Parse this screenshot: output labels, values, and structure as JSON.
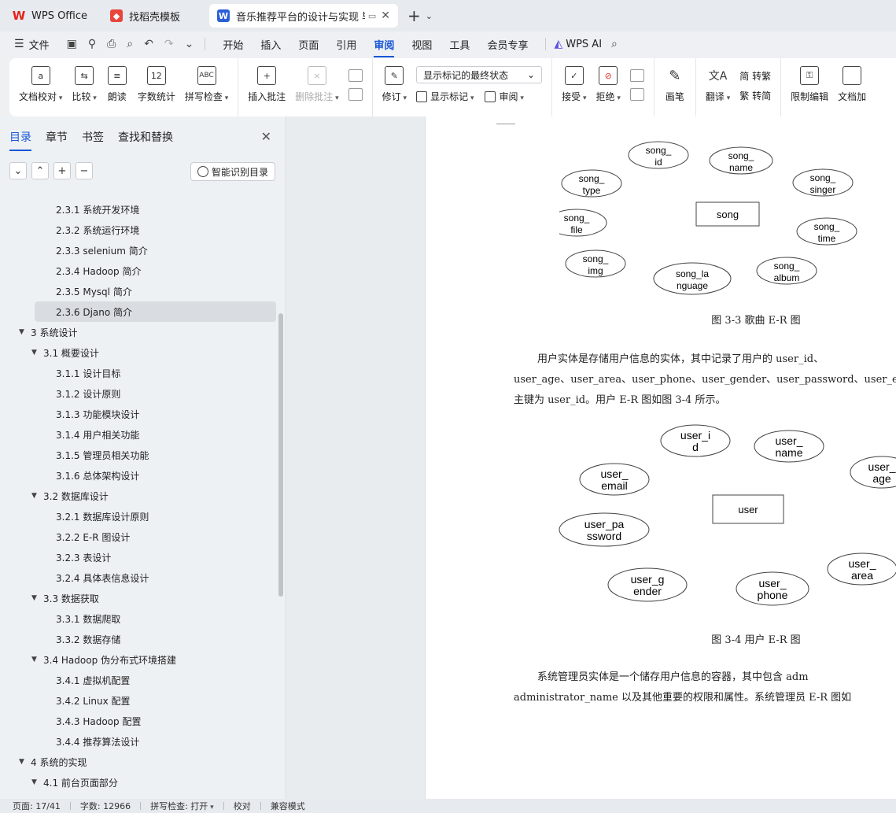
{
  "tabs": [
    {
      "label": "WPS Office"
    },
    {
      "label": "找稻壳模板"
    },
    {
      "label": "音乐推荐平台的设计与实现 毕"
    }
  ],
  "menu": {
    "file": "文件",
    "items": [
      "开始",
      "插入",
      "页面",
      "引用",
      "审阅",
      "视图",
      "工具",
      "会员专享"
    ],
    "active": "审阅",
    "ai": "WPS AI"
  },
  "ribbon": {
    "g1": [
      "文档校对",
      "比较",
      "朗读",
      "字数统计",
      "拼写检查"
    ],
    "g2": [
      "插入批注",
      "删除批注"
    ],
    "g3": {
      "revise": "修订",
      "display_select": "显示标记的最终状态",
      "show_markup": "显示标记",
      "review": "审阅"
    },
    "g4": [
      "接受",
      "拒绝"
    ],
    "pen": "画笔",
    "translate": "翻译",
    "to_trad": "简 转繁",
    "to_simp": "繁 转简",
    "restrict": "限制编辑",
    "doc_add": "文档加"
  },
  "sidepanel": {
    "tabs": [
      "目录",
      "章节",
      "书签",
      "查找和替换"
    ],
    "smart_toc": "智能识别目录",
    "toc": [
      {
        "level": 3,
        "text": "2.3.1 系统开发环境"
      },
      {
        "level": 3,
        "text": "2.3.2 系统运行环境"
      },
      {
        "level": 3,
        "text": "2.3.3 selenium 简介"
      },
      {
        "level": 3,
        "text": "2.3.4 Hadoop 简介"
      },
      {
        "level": 3,
        "text": "2.3.5 Mysql 简介"
      },
      {
        "level": 3,
        "text": "2.3.6 Djano 简介",
        "selected": true
      },
      {
        "level": 1,
        "text": "3 系统设计"
      },
      {
        "level": 2,
        "text": "3.1  概要设计"
      },
      {
        "level": 3,
        "text": "3.1.1 设计目标"
      },
      {
        "level": 3,
        "text": "3.1.2  设计原则"
      },
      {
        "level": 3,
        "text": "3.1.3  功能模块设计"
      },
      {
        "level": 3,
        "text": "3.1.4  用户相关功能"
      },
      {
        "level": 3,
        "text": "3.1.5  管理员相关功能"
      },
      {
        "level": 3,
        "text": "3.1.6  总体架构设计"
      },
      {
        "level": 2,
        "text": "3.2  数据库设计"
      },
      {
        "level": 3,
        "text": "3.2.1 数据库设计原则"
      },
      {
        "level": 3,
        "text": "3.2.2 E-R 图设计"
      },
      {
        "level": 3,
        "text": "3.2.3 表设计"
      },
      {
        "level": 3,
        "text": "3.2.4 具体表信息设计"
      },
      {
        "level": 2,
        "text": "3.3 数据获取"
      },
      {
        "level": 3,
        "text": "3.3.1 数据爬取"
      },
      {
        "level": 3,
        "text": "3.3.2  数据存储"
      },
      {
        "level": 2,
        "text": "3.4 Hadoop 伪分布式环境搭建"
      },
      {
        "level": 3,
        "text": "3.4.1 虚拟机配置"
      },
      {
        "level": 3,
        "text": "3.4.2 Linux 配置"
      },
      {
        "level": 3,
        "text": "3.4.3 Hadoop 配置"
      },
      {
        "level": 3,
        "text": "3.4.4 推荐算法设计"
      },
      {
        "level": 1,
        "text": "4 系统的实现"
      },
      {
        "level": 2,
        "text": "4.1  前台页面部分"
      }
    ]
  },
  "document": {
    "song_er": {
      "entity": "song",
      "attributes": [
        [
          "song_",
          "id"
        ],
        [
          "song_",
          "name"
        ],
        [
          "song_",
          "type"
        ],
        [
          "song_",
          "singer"
        ],
        [
          "song_",
          "file"
        ],
        [
          "song_",
          "time"
        ],
        [
          "song_",
          "img"
        ],
        [
          "song_la",
          "nguage"
        ],
        [
          "song_",
          "album"
        ]
      ]
    },
    "caption1": "图 3-3 歌曲 E-R 图",
    "para1": [
      "用户实体是存储用户信息的实体，其中记录了用户的 user_id、",
      "user_age、user_area、user_phone、user_gender、user_password、user_e",
      "主键为 user_id。用户 E-R 图如图 3-4 所示。"
    ],
    "user_er": {
      "entity": "user",
      "attributes": [
        [
          "user_i",
          "d"
        ],
        [
          "user_",
          "name"
        ],
        [
          "user_",
          "age"
        ],
        [
          "user_",
          "email"
        ],
        [
          "user_pa",
          "ssword"
        ],
        [
          "user_",
          "area"
        ],
        [
          "user_g",
          "ender"
        ],
        [
          "user_",
          "phone"
        ]
      ]
    },
    "caption2": "图 3-4  用户 E-R 图",
    "para2": [
      "系统管理员实体是一个储存用户信息的容器，其中包含 adm",
      "administrator_name 以及其他重要的权限和属性。系统管理员 E-R 图如"
    ]
  },
  "status": {
    "page": "页面: 17/41",
    "words": "字数: 12966",
    "spell": "拼写检查: 打开",
    "proof": "校对",
    "compat": "兼容模式"
  }
}
